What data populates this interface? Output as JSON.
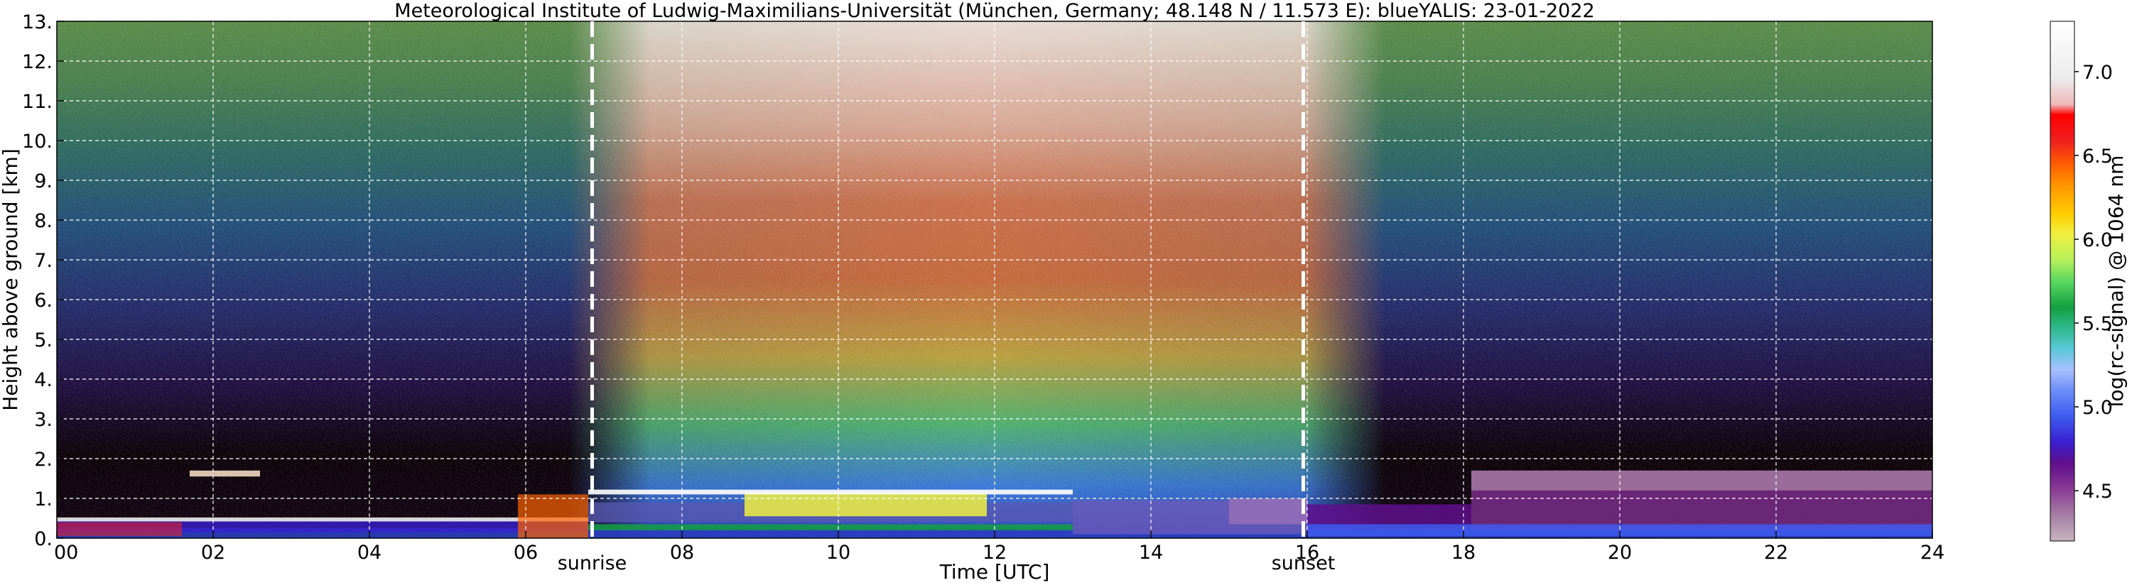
{
  "chart_data": {
    "type": "heatmap",
    "title": "Meteorological Institute of Ludwig-Maximilians-Universität (München, Germany; 48.148 N / 11.573 E):    blueYALIS: 23-01-2022",
    "xlabel": "Time [UTC]",
    "ylabel": "Height above ground [km]",
    "xlim": [
      0,
      24
    ],
    "ylim": [
      0,
      13
    ],
    "x_tick_labels": [
      "00",
      "02",
      "04",
      "06",
      "08",
      "10",
      "12",
      "14",
      "16",
      "18",
      "20",
      "22",
      "24"
    ],
    "x_tick_values": [
      0,
      2,
      4,
      6,
      8,
      10,
      12,
      14,
      16,
      18,
      20,
      22,
      24
    ],
    "y_tick_labels": [
      "0.",
      "1.",
      "2.",
      "3.",
      "4.",
      "5.",
      "6.",
      "7.",
      "8.",
      "9.",
      "10.",
      "11.",
      "12.",
      "13."
    ],
    "y_tick_values": [
      0,
      1,
      2,
      3,
      4,
      5,
      6,
      7,
      8,
      9,
      10,
      11,
      12,
      13
    ],
    "grid": true,
    "markers": [
      {
        "label": "sunrise",
        "x": 6.85
      },
      {
        "label": "sunset",
        "x": 15.95
      }
    ],
    "colorbar": {
      "label": "log(rc-signal) @ 1064 nm",
      "range": [
        4.2,
        7.3
      ],
      "tick_labels": [
        "4.5",
        "5.0",
        "5.5",
        "6.0",
        "6.5",
        "7.0"
      ],
      "tick_values": [
        4.5,
        5.0,
        5.5,
        6.0,
        6.5,
        7.0
      ],
      "colors": [
        "#b8a0b0",
        "#9a6f98",
        "#7a2d88",
        "#5f0f8a",
        "#3a1fd0",
        "#3d5cf0",
        "#6c8ef7",
        "#a8c0ff",
        "#58c8d8",
        "#2fb88a",
        "#14a040",
        "#5ad860",
        "#b5f05a",
        "#f0f040",
        "#ffcc00",
        "#ff9a00",
        "#ff6400",
        "#f02020",
        "#f0b8b8",
        "#ececec",
        "#ffffff"
      ]
    }
  }
}
